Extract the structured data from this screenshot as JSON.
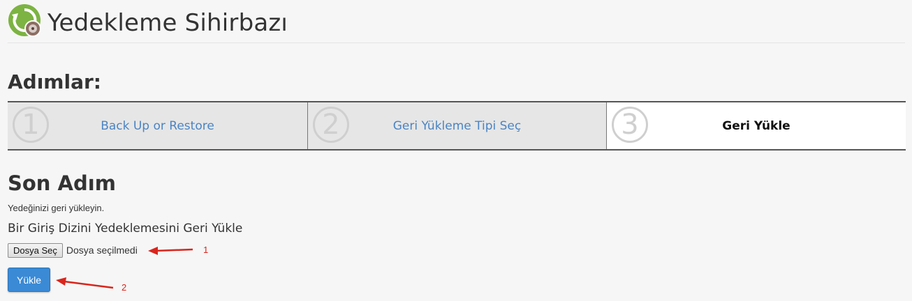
{
  "header": {
    "title": "Yedekleme Sihirbazı",
    "logo_icon": "backup-wizard-icon"
  },
  "steps_section": {
    "title": "Adımlar:",
    "steps": [
      {
        "number": "1",
        "label": "Back Up or Restore",
        "state": "link"
      },
      {
        "number": "2",
        "label": "Geri Yükleme Tipi Seç",
        "state": "link"
      },
      {
        "number": "3",
        "label": "Geri Yükle",
        "state": "active"
      }
    ]
  },
  "final_step": {
    "title": "Son Adım",
    "description": "Yedeğinizi geri yükleyin.",
    "restore_heading": "Bir Giriş Dizini Yedeklemesini Geri Yükle",
    "file_button_label": "Dosya Seç",
    "file_status": "Dosya seçilmedi",
    "upload_button_label": "Yükle"
  },
  "annotations": {
    "marker_1": "1",
    "marker_2": "2",
    "color": "#d9251c"
  },
  "colors": {
    "link": "#4a84c4",
    "primary_button": "#3a8ad6",
    "inactive_step_bg": "#e6e6e6"
  }
}
